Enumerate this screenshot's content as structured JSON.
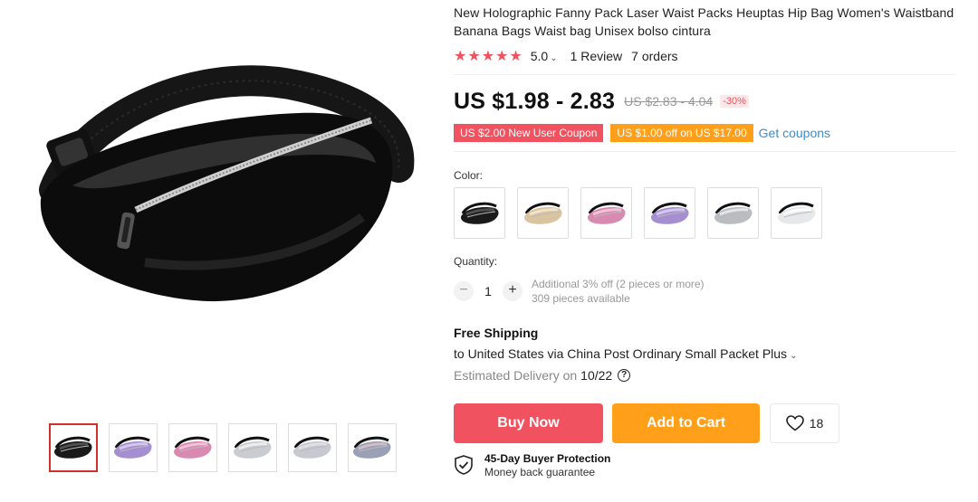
{
  "product": {
    "title": "New Holographic Fanny Pack Laser Waist Packs Heuptas Hip Bag Women's Waistband Banana Bags Waist bag Unisex bolso cintura",
    "main_image_icon": "black-fanny-pack-image"
  },
  "rating": {
    "stars": "★★★★★",
    "score": "5.0",
    "chevron": "⌄",
    "reviews": "1 Review",
    "orders": "7 orders",
    "star_color": "#f0525f"
  },
  "price": {
    "current": "US $1.98 - 2.83",
    "original": "US $2.83 - 4.04",
    "discount": "-30%"
  },
  "coupons": {
    "items": [
      {
        "label": "US $2.00 New User Coupon",
        "color": "#f0525f"
      },
      {
        "label": "US $1.00 off on US $17.00",
        "color": "#ff9f1a"
      }
    ],
    "get_coupons": "Get coupons"
  },
  "color_section": {
    "label": "Color:",
    "swatches": [
      {
        "name": "black",
        "body": "#1a1a1a",
        "hi": "#555555"
      },
      {
        "name": "gold",
        "body": "#d9c3a0",
        "hi": "#f3e6cf"
      },
      {
        "name": "pink",
        "body": "#d88ab0",
        "hi": "#f5c7dd"
      },
      {
        "name": "purple",
        "body": "#a58fd0",
        "hi": "#d9cdf0"
      },
      {
        "name": "silver",
        "body": "#b9bcc0",
        "hi": "#e8e9eb"
      },
      {
        "name": "white",
        "body": "#e6e8ea",
        "hi": "#ffffff"
      }
    ]
  },
  "quantity": {
    "label": "Quantity:",
    "minus": "−",
    "value": "1",
    "plus": "+",
    "note_line1": "Additional 3% off (2 pieces or more)",
    "note_line2": "309 pieces available"
  },
  "shipping": {
    "title": "Free Shipping",
    "destination": "to United States via China Post Ordinary Small Packet Plus",
    "delivery_label": "Estimated Delivery on",
    "delivery_date": "10/22",
    "help": "?"
  },
  "actions": {
    "buy_now": "Buy Now",
    "add_to_cart": "Add to Cart",
    "wishlist_count": "18",
    "buy_color": "#f0525f",
    "cart_color": "#ff9f1a"
  },
  "protection": {
    "title": "45-Day Buyer Protection",
    "subtitle": "Money back guarantee"
  },
  "gallery": {
    "thumbnails": [
      {
        "name": "thumb-black",
        "body": "#1a1a1a",
        "hi": "#555555"
      },
      {
        "name": "thumb-purple",
        "body": "#a58fd0",
        "hi": "#d9cdf0"
      },
      {
        "name": "thumb-pink",
        "body": "#d88ab0",
        "hi": "#f5c7dd"
      },
      {
        "name": "thumb-silver",
        "body": "#c9ccd0",
        "hi": "#f0f1f2"
      },
      {
        "name": "thumb-model-1",
        "body": "#c8c8d0",
        "hi": "#e0e0e8"
      },
      {
        "name": "thumb-model-2",
        "body": "#9aa0b5",
        "hi": "#d8c0c8"
      }
    ]
  }
}
